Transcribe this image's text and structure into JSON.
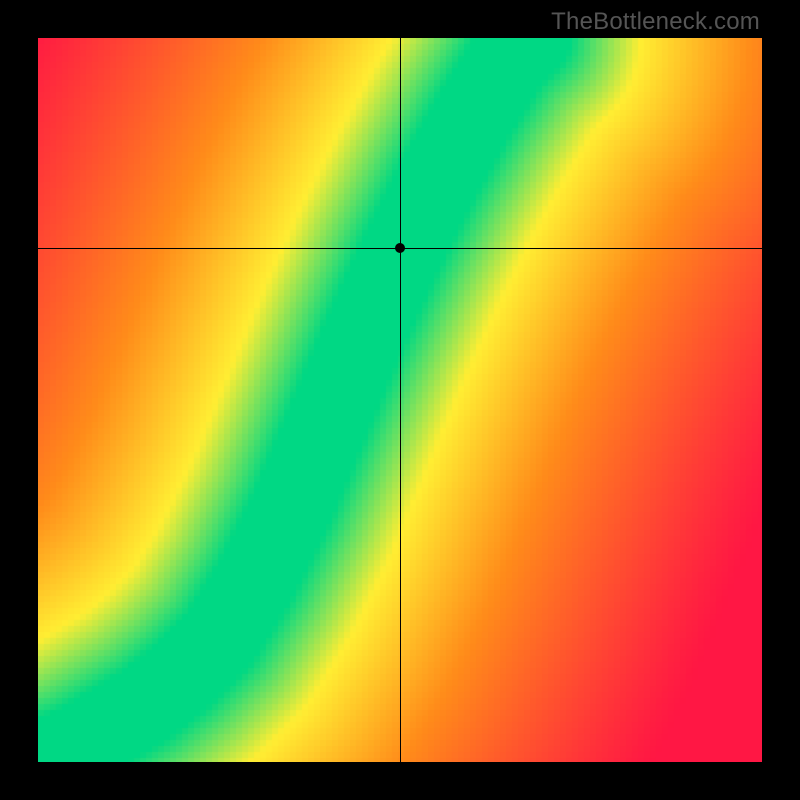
{
  "watermark": "TheBottleneck.com",
  "chart_data": {
    "type": "heatmap",
    "title": "",
    "xlabel": "",
    "ylabel": "",
    "xlim": [
      0,
      1
    ],
    "ylim": [
      0,
      1
    ],
    "grid": false,
    "legend_position": "none",
    "crosshair": {
      "x": 0.5,
      "y": 0.71
    },
    "optimal_curve": [
      {
        "x": 0.0,
        "y": 0.0
      },
      {
        "x": 0.05,
        "y": 0.02
      },
      {
        "x": 0.1,
        "y": 0.05
      },
      {
        "x": 0.15,
        "y": 0.08
      },
      {
        "x": 0.2,
        "y": 0.12
      },
      {
        "x": 0.25,
        "y": 0.17
      },
      {
        "x": 0.3,
        "y": 0.25
      },
      {
        "x": 0.35,
        "y": 0.35
      },
      {
        "x": 0.4,
        "y": 0.47
      },
      {
        "x": 0.45,
        "y": 0.59
      },
      {
        "x": 0.5,
        "y": 0.7
      },
      {
        "x": 0.55,
        "y": 0.8
      },
      {
        "x": 0.6,
        "y": 0.89
      },
      {
        "x": 0.65,
        "y": 0.97
      },
      {
        "x": 0.68,
        "y": 1.0
      }
    ],
    "band_half_width": 0.055,
    "colors": {
      "optimal_green": "#00d884",
      "yellow": "#ffee33",
      "orange": "#ff8c1a",
      "red": "#ff1744"
    }
  }
}
